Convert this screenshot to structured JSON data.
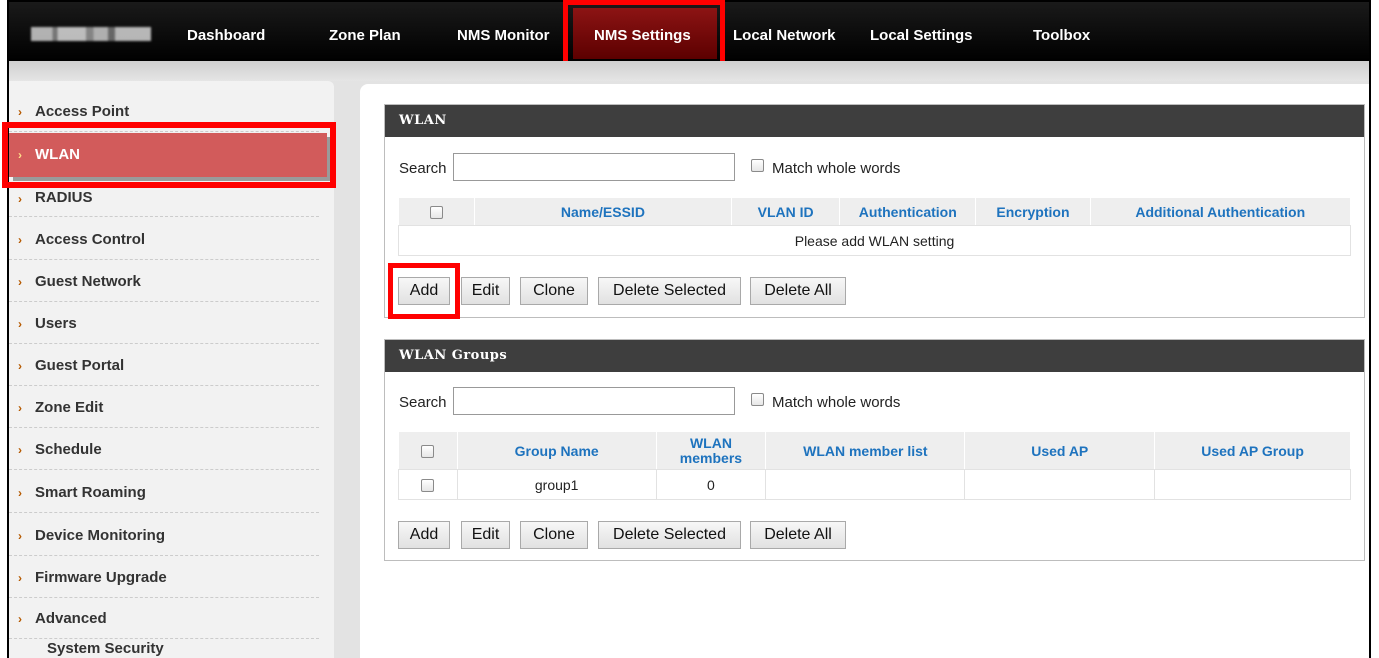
{
  "topnav": {
    "items": [
      {
        "label": "Dashboard"
      },
      {
        "label": "Zone Plan"
      },
      {
        "label": "NMS Monitor"
      },
      {
        "label": "NMS Settings",
        "active": true
      },
      {
        "label": "Local Network"
      },
      {
        "label": "Local Settings"
      },
      {
        "label": "Toolbox"
      }
    ]
  },
  "sidebar": {
    "items": [
      {
        "label": "Access Point"
      },
      {
        "label": "WLAN",
        "active": true
      },
      {
        "label": "RADIUS"
      },
      {
        "label": "Access Control"
      },
      {
        "label": "Guest Network"
      },
      {
        "label": "Users"
      },
      {
        "label": "Guest Portal"
      },
      {
        "label": "Zone Edit"
      },
      {
        "label": "Schedule"
      },
      {
        "label": "Smart Roaming"
      },
      {
        "label": "Device Monitoring"
      },
      {
        "label": "Firmware Upgrade"
      },
      {
        "label": "Advanced"
      }
    ],
    "sub_item": "System Security",
    "chevron": "›"
  },
  "wlan": {
    "title": "WLAN",
    "search_label": "Search",
    "search_value": "",
    "match_label": "Match whole words",
    "columns": [
      "Name/ESSID",
      "VLAN ID",
      "Authentication",
      "Encryption",
      "Additional Authentication"
    ],
    "empty_message": "Please add WLAN setting",
    "buttons": [
      "Add",
      "Edit",
      "Clone",
      "Delete Selected",
      "Delete All"
    ]
  },
  "wlan_groups": {
    "title": "WLAN Groups",
    "search_label": "Search",
    "search_value": "",
    "match_label": "Match whole words",
    "columns": [
      "Group Name",
      "WLAN members",
      "WLAN member list",
      "Used AP",
      "Used AP Group"
    ],
    "rows": [
      {
        "group_name": "group1",
        "members": "0",
        "member_list": "",
        "used_ap": "",
        "used_ap_group": ""
      }
    ],
    "buttons": [
      "Add",
      "Edit",
      "Clone",
      "Delete Selected",
      "Delete All"
    ]
  },
  "colors": {
    "nav_bg": "#000000",
    "nav_active": "#7a0a0a",
    "highlight": "#ff0000",
    "sidebar_active": "#d25b5b",
    "table_header_text": "#1e73be",
    "panel_header": "#3e3e3e"
  }
}
